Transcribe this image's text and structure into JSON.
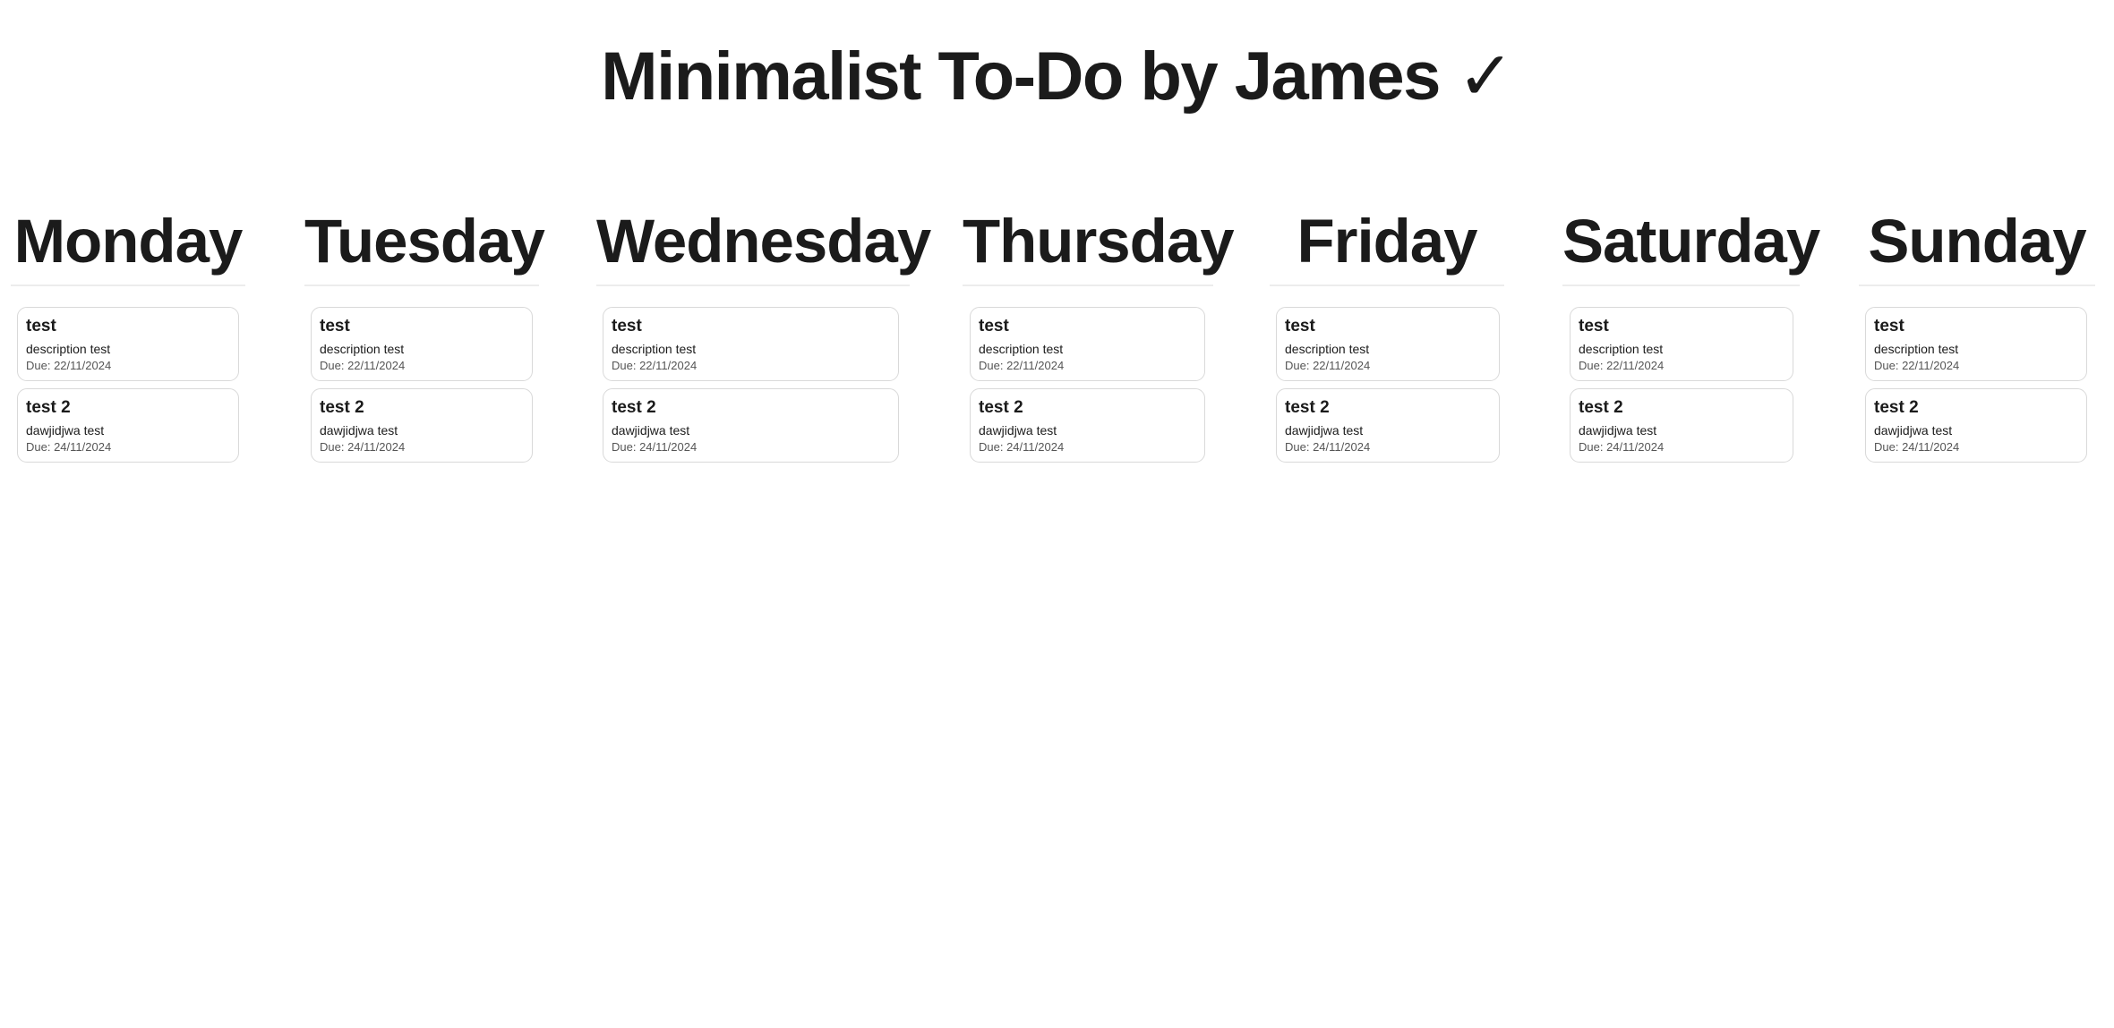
{
  "header": {
    "title": "Minimalist To-Do by James",
    "check_glyph": "✓"
  },
  "days": [
    {
      "name": "Monday",
      "tasks": [
        {
          "title": "test",
          "description": "description test",
          "due": "Due: 22/11/2024"
        },
        {
          "title": "test 2",
          "description": "dawjidjwa test",
          "due": "Due: 24/11/2024"
        }
      ]
    },
    {
      "name": "Tuesday",
      "tasks": [
        {
          "title": "test",
          "description": "description test",
          "due": "Due: 22/11/2024"
        },
        {
          "title": "test 2",
          "description": "dawjidjwa test",
          "due": "Due: 24/11/2024"
        }
      ]
    },
    {
      "name": "Wednesday",
      "tasks": [
        {
          "title": "test",
          "description": "description test",
          "due": "Due: 22/11/2024"
        },
        {
          "title": "test 2",
          "description": "dawjidjwa test",
          "due": "Due: 24/11/2024"
        }
      ]
    },
    {
      "name": "Thursday",
      "tasks": [
        {
          "title": "test",
          "description": "description test",
          "due": "Due: 22/11/2024"
        },
        {
          "title": "test 2",
          "description": "dawjidjwa test",
          "due": "Due: 24/11/2024"
        }
      ]
    },
    {
      "name": "Friday",
      "tasks": [
        {
          "title": "test",
          "description": "description test",
          "due": "Due: 22/11/2024"
        },
        {
          "title": "test 2",
          "description": "dawjidjwa test",
          "due": "Due: 24/11/2024"
        }
      ]
    },
    {
      "name": "Saturday",
      "tasks": [
        {
          "title": "test",
          "description": "description test",
          "due": "Due: 22/11/2024"
        },
        {
          "title": "test 2",
          "description": "dawjidjwa test",
          "due": "Due: 24/11/2024"
        }
      ]
    },
    {
      "name": "Sunday",
      "tasks": [
        {
          "title": "test",
          "description": "description test",
          "due": "Due: 22/11/2024"
        },
        {
          "title": "test 2",
          "description": "dawjidjwa test",
          "due": "Due: 24/11/2024"
        }
      ]
    }
  ]
}
